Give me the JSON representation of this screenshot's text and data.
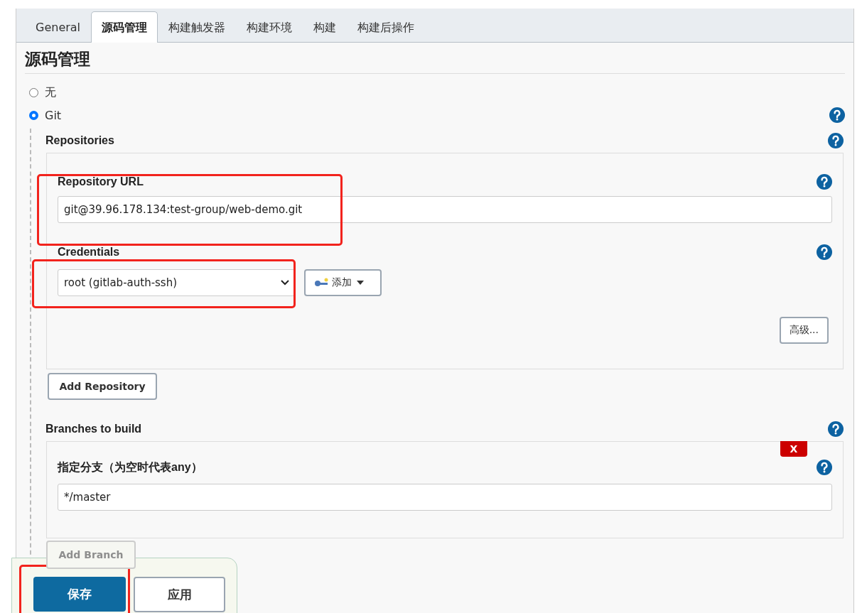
{
  "tabs": [
    {
      "label": "General",
      "selected": false
    },
    {
      "label": "源码管理",
      "selected": true
    },
    {
      "label": "构建触发器",
      "selected": false
    },
    {
      "label": "构建环境",
      "selected": false
    },
    {
      "label": "构建",
      "selected": false
    },
    {
      "label": "构建后操作",
      "selected": false
    }
  ],
  "section_title": "源码管理",
  "scm_options": [
    {
      "label": "无",
      "selected": false,
      "help": false
    },
    {
      "label": "Git",
      "selected": true,
      "help": true
    }
  ],
  "repositories": {
    "title": "Repositories",
    "repository_url": {
      "label": "Repository URL",
      "value": "git@39.96.178.134:test-group/web-demo.git",
      "highlighted": true
    },
    "credentials": {
      "label": "Credentials",
      "value": "root (gitlab-auth-ssh)",
      "highlighted": true,
      "add_button": "添加"
    },
    "advanced_button": "高级...",
    "add_button": "Add Repository"
  },
  "branches": {
    "title": "Branches to build",
    "delete_button": "X",
    "branch_specifier": {
      "label": "指定分支（为空时代表any）",
      "value": "*/master"
    },
    "add_button": "Add Branch"
  },
  "footer": {
    "save_button": {
      "label": "保存",
      "highlighted": true
    },
    "apply_button": "应用"
  }
}
